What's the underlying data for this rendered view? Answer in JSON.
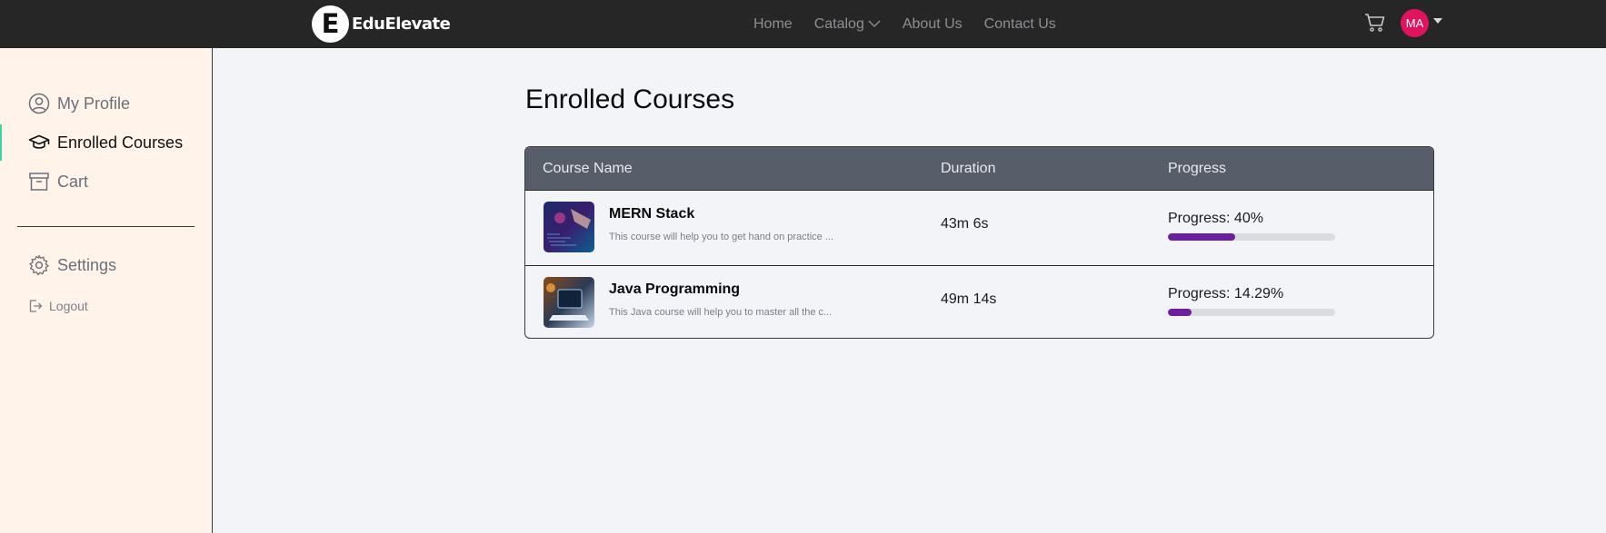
{
  "brand": {
    "mark": "E",
    "name": "EduElevate"
  },
  "nav": {
    "links": [
      {
        "label": "Home"
      },
      {
        "label": "Catalog"
      },
      {
        "label": "About Us"
      },
      {
        "label": "Contact Us"
      }
    ],
    "avatar_initials": "MA"
  },
  "sidebar": {
    "items": [
      {
        "label": "My Profile",
        "icon": "user-circle-icon"
      },
      {
        "label": "Enrolled Courses",
        "icon": "graduation-cap-icon",
        "active": true
      },
      {
        "label": "Cart",
        "icon": "archive-box-icon"
      }
    ],
    "settings": {
      "label": "Settings",
      "icon": "gear-icon"
    },
    "logout": {
      "label": "Logout",
      "icon": "logout-icon"
    }
  },
  "main": {
    "title": "Enrolled Courses",
    "table": {
      "headers": [
        "Course Name",
        "Duration",
        "Progress"
      ],
      "rows": [
        {
          "name": "MERN Stack",
          "description": "This course will help you to get hand on practice ...",
          "duration": "43m 6s",
          "progress_label": "Progress: 40%",
          "progress": 0.4
        },
        {
          "name": "Java Programming",
          "description": "This Java course will help you to master all the c...",
          "duration": "49m 14s",
          "progress_label": "Progress: 14.29%",
          "progress": 0.1429
        }
      ]
    }
  },
  "colors": {
    "navbar": "#262626",
    "sidebar_bg": "#fff3ea",
    "active_indicator": "#40d3a0",
    "table_header": "#585d6a",
    "progress_fill": "#6b1fa0",
    "avatar": "#e0145e"
  }
}
